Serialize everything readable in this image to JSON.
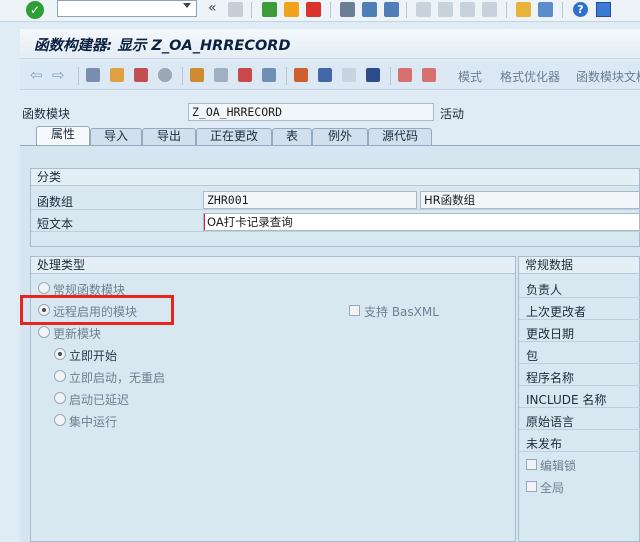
{
  "titlebar": {
    "title": "函数构建器: 显示 Z_OA_HRRECORD"
  },
  "apptoolbar": {
    "mode_label": "模式",
    "pretty_printer_label": "格式优化器",
    "function_module_doc_label": "函数模块文档"
  },
  "header": {
    "fm_label": "函数模块",
    "fm_value": "Z_OA_HRRECORD",
    "status": "活动"
  },
  "tabs": [
    {
      "label": "属性"
    },
    {
      "label": "导入"
    },
    {
      "label": "导出"
    },
    {
      "label": "正在更改"
    },
    {
      "label": "表"
    },
    {
      "label": "例外"
    },
    {
      "label": "源代码"
    }
  ],
  "classification": {
    "title": "分类",
    "group_label": "函数组",
    "group_value": "ZHR001",
    "group_desc": "HR函数组",
    "short_text_label": "短文本",
    "short_text_value": "OA打卡记录查询"
  },
  "processing": {
    "title": "处理类型",
    "normal": "常规函数模块",
    "remote": "远程启用的模块",
    "basxml": "支持 BasXML",
    "update": "更新模块",
    "start_immediately": "立即开始",
    "immediate_no_restart": "立即启动，无重启",
    "delayed": "启动已延迟",
    "collective": "集中运行"
  },
  "general": {
    "title": "常规数据",
    "owner": "负责人",
    "last_changed_by": "上次更改者",
    "changed_on": "更改日期",
    "package": "包",
    "program_name": "程序名称",
    "include_name": "INCLUDE 名称",
    "original_language": "原始语言",
    "not_released": "未发布",
    "edit_lock": "编辑锁",
    "global": "全局"
  },
  "colors": {
    "highlight": "#e8241f",
    "panel_bg": "#d5e6f0"
  }
}
